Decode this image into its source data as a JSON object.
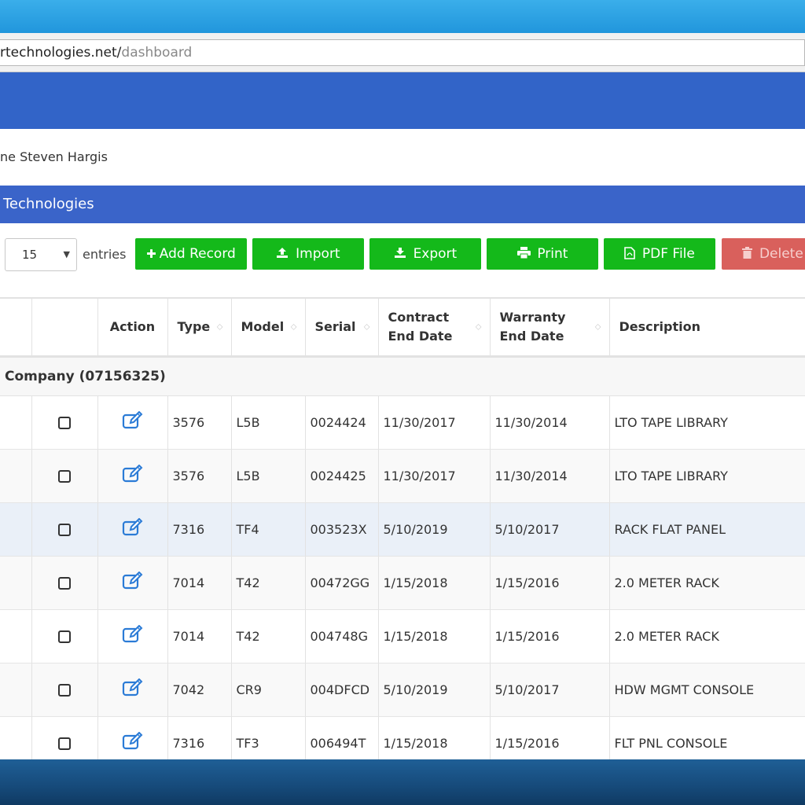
{
  "browser": {
    "url_host": "rtechnologies.net/",
    "url_path": "dashboard"
  },
  "welcome_text": "ne Steven Hargis",
  "panel_title": "Technologies",
  "toolbar": {
    "page_length": "15",
    "entries_label": "entries",
    "buttons": [
      {
        "label": "Add Record",
        "icon": "plus-icon"
      },
      {
        "label": "Import",
        "icon": "upload-icon"
      },
      {
        "label": "Export",
        "icon": "download-icon"
      },
      {
        "label": "Print",
        "icon": "print-icon"
      },
      {
        "label": "PDF File",
        "icon": "pdf-icon"
      },
      {
        "label": "Delete",
        "icon": "trash-icon"
      }
    ]
  },
  "table": {
    "headers": {
      "action": "Action",
      "type": "Type",
      "model": "Model",
      "serial": "Serial",
      "contract_1": "Contract",
      "contract_2": "End Date",
      "warranty_1": "Warranty",
      "warranty_2": "End Date",
      "description": "Description"
    },
    "group_label": "Company (07156325)",
    "rows": [
      {
        "type": "3576",
        "model": "L5B",
        "serial": "0024424",
        "contract_end": "11/30/2017",
        "warranty_end": "11/30/2014",
        "description": "LTO TAPE LIBRARY"
      },
      {
        "type": "3576",
        "model": "L5B",
        "serial": "0024425",
        "contract_end": "11/30/2017",
        "warranty_end": "11/30/2014",
        "description": "LTO TAPE LIBRARY"
      },
      {
        "type": "7316",
        "model": "TF4",
        "serial": "003523X",
        "contract_end": "5/10/2019",
        "warranty_end": "5/10/2017",
        "description": "RACK FLAT PANEL"
      },
      {
        "type": "7014",
        "model": "T42",
        "serial": "00472GG",
        "contract_end": "1/15/2018",
        "warranty_end": "1/15/2016",
        "description": "2.0 METER RACK"
      },
      {
        "type": "7014",
        "model": "T42",
        "serial": "004748G",
        "contract_end": "1/15/2018",
        "warranty_end": "1/15/2016",
        "description": "2.0 METER RACK"
      },
      {
        "type": "7042",
        "model": "CR9",
        "serial": "004DFCD",
        "contract_end": "5/10/2019",
        "warranty_end": "5/10/2017",
        "description": "HDW MGMT CONSOLE"
      },
      {
        "type": "7316",
        "model": "TF3",
        "serial": "006494T",
        "contract_end": "1/15/2018",
        "warranty_end": "1/15/2016",
        "description": "FLT PNL CONSOLE"
      }
    ]
  },
  "colors": {
    "nav_blue": "#3264c8",
    "button_green": "#14b91a",
    "button_red": "#d9605c",
    "edit_icon_blue": "#2b7bd6"
  }
}
